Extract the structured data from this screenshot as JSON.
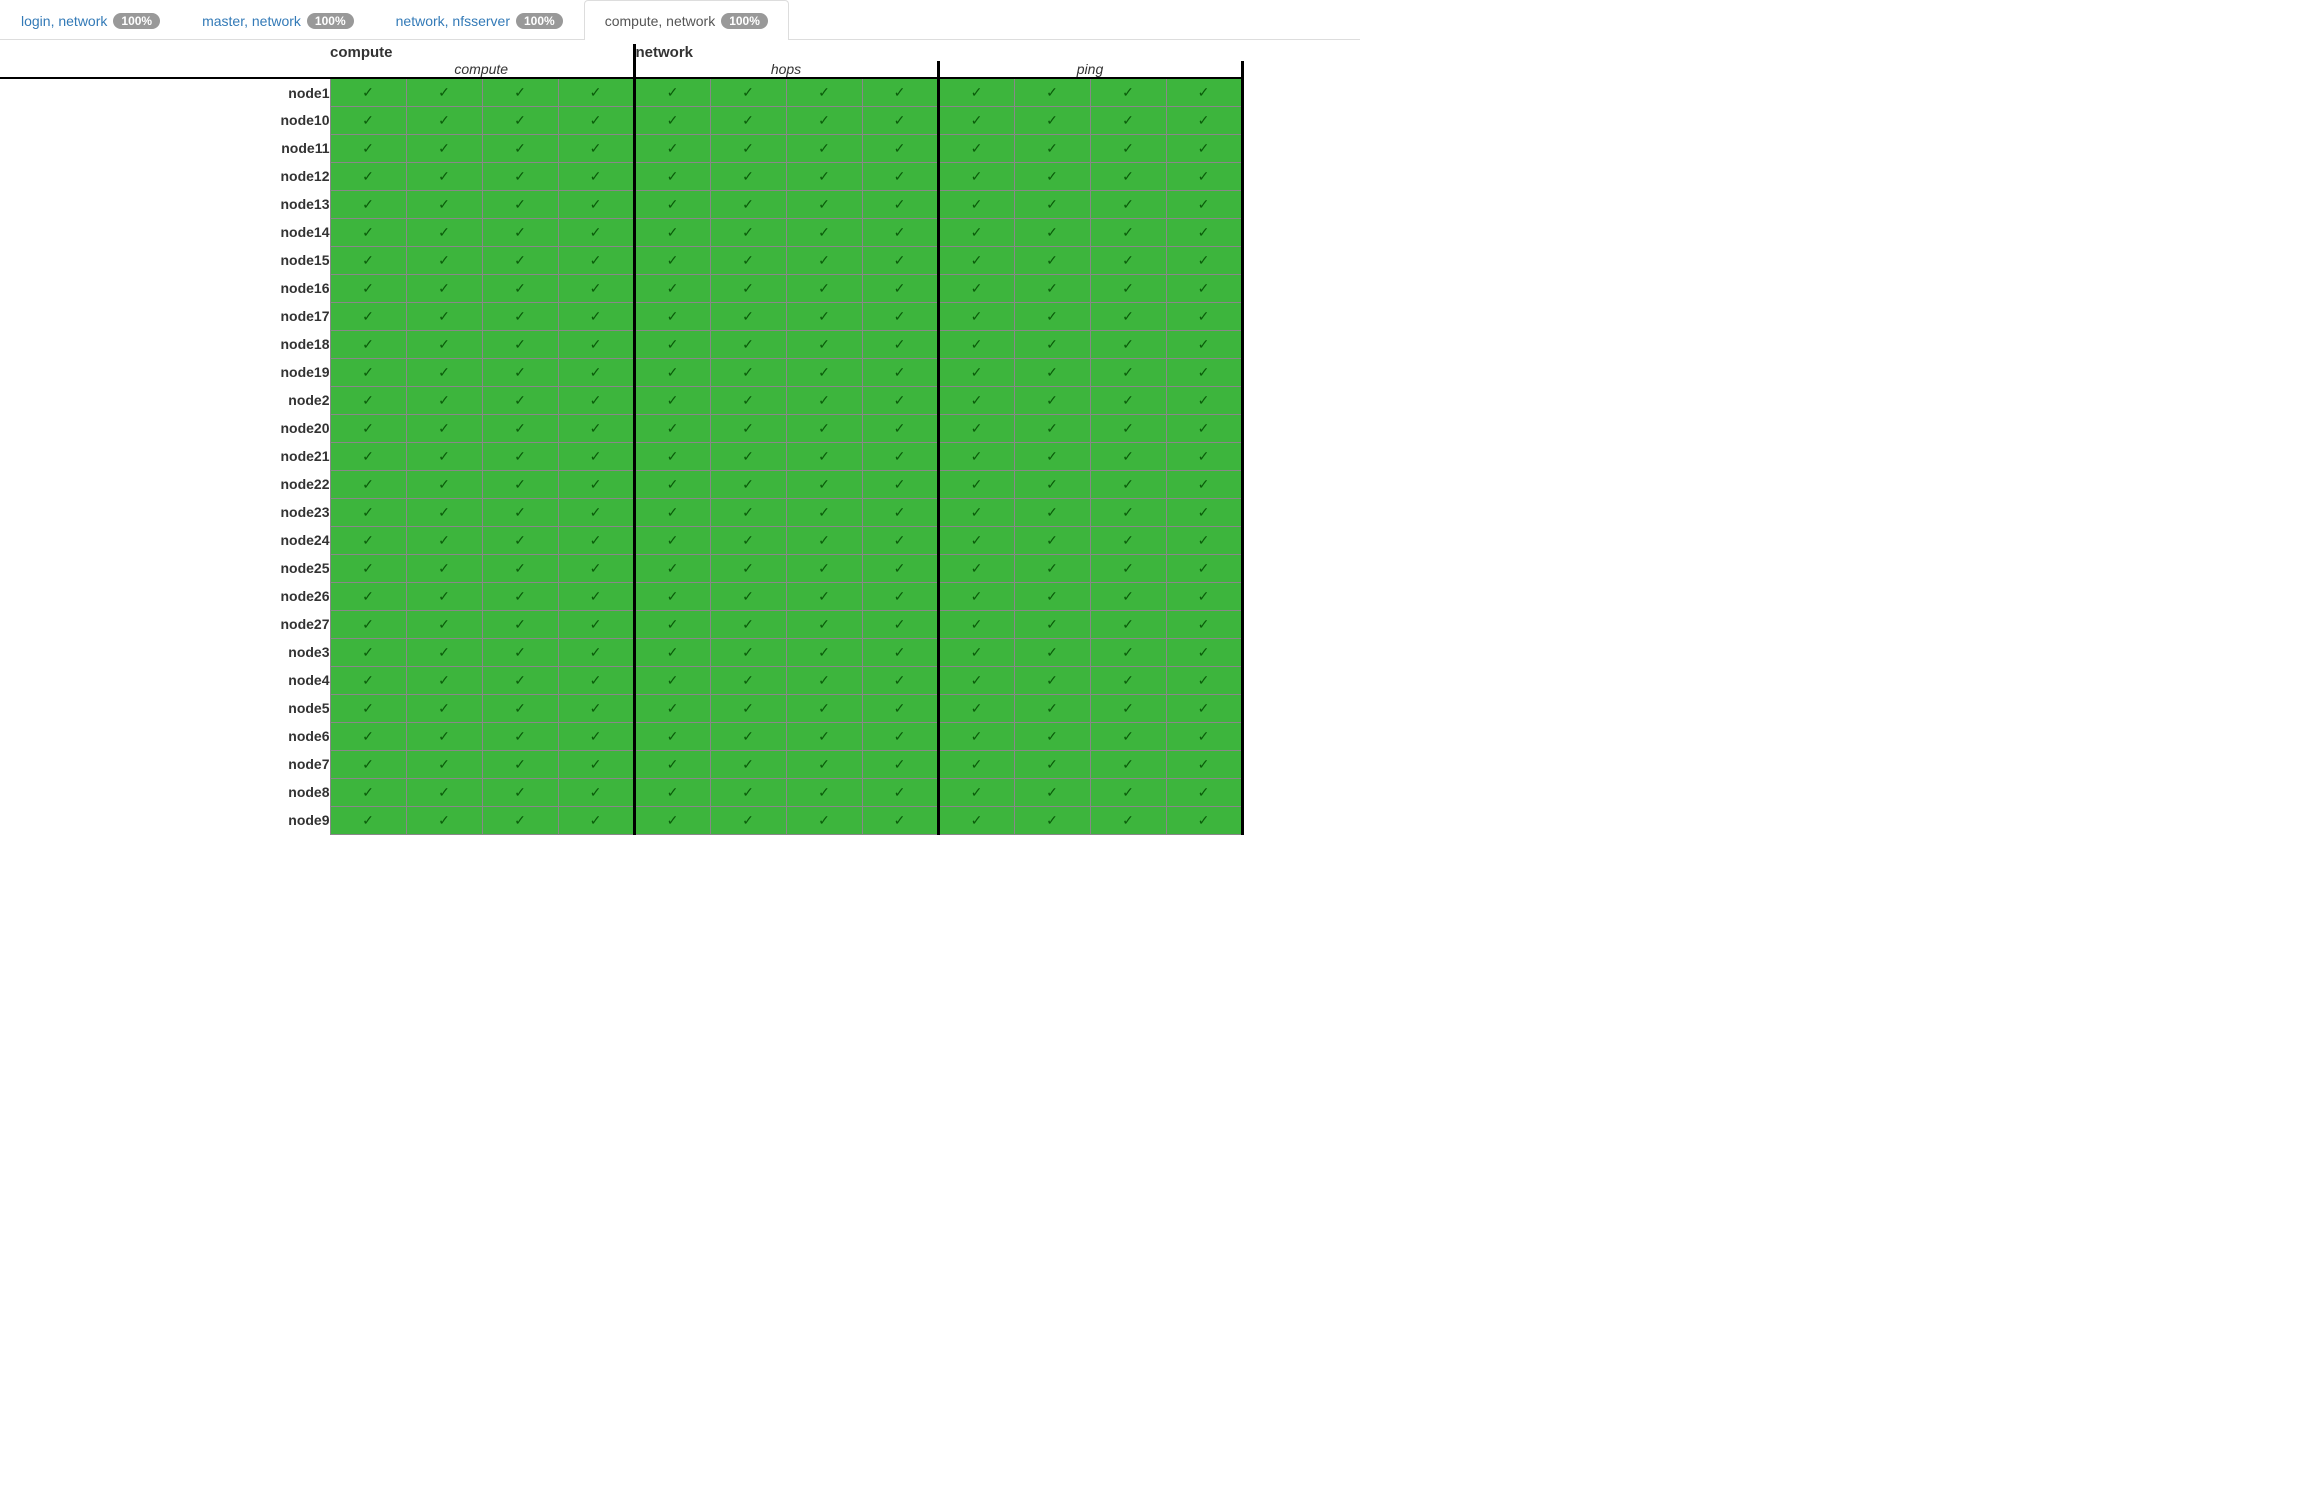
{
  "tabs": [
    {
      "label": "login, network",
      "badge": "100%",
      "active": false
    },
    {
      "label": "master, network",
      "badge": "100%",
      "active": false
    },
    {
      "label": "network, nfsserver",
      "badge": "100%",
      "active": false
    },
    {
      "label": "compute, network",
      "badge": "100%",
      "active": true
    }
  ],
  "groups": [
    {
      "name": "compute",
      "subgroups": [
        {
          "name": "compute",
          "cols": 4
        }
      ]
    },
    {
      "name": "network",
      "subgroups": [
        {
          "name": "hops",
          "cols": 4
        },
        {
          "name": "ping",
          "cols": 4
        }
      ]
    }
  ],
  "check_glyph": "✓",
  "nodes": [
    {
      "label": "node1",
      "cells": [
        "ok",
        "ok",
        "ok",
        "ok",
        "ok",
        "ok",
        "ok",
        "ok",
        "ok",
        "ok",
        "ok",
        "ok"
      ]
    },
    {
      "label": "node10",
      "cells": [
        "ok",
        "ok",
        "ok",
        "ok",
        "ok",
        "ok",
        "ok",
        "ok",
        "ok",
        "ok",
        "ok",
        "ok"
      ]
    },
    {
      "label": "node11",
      "cells": [
        "ok",
        "ok",
        "ok",
        "ok",
        "ok",
        "ok",
        "ok",
        "ok",
        "ok",
        "ok",
        "ok",
        "ok"
      ]
    },
    {
      "label": "node12",
      "cells": [
        "ok",
        "ok",
        "ok",
        "ok",
        "ok",
        "ok",
        "ok",
        "ok",
        "ok",
        "ok",
        "ok",
        "ok"
      ]
    },
    {
      "label": "node13",
      "cells": [
        "ok",
        "ok",
        "ok",
        "ok",
        "ok",
        "ok",
        "ok",
        "ok",
        "ok",
        "ok",
        "ok",
        "ok"
      ]
    },
    {
      "label": "node14",
      "cells": [
        "ok",
        "ok",
        "ok",
        "ok",
        "ok",
        "ok",
        "ok",
        "ok",
        "ok",
        "ok",
        "ok",
        "ok"
      ]
    },
    {
      "label": "node15",
      "cells": [
        "ok",
        "ok",
        "ok",
        "ok",
        "ok",
        "ok",
        "ok",
        "ok",
        "ok",
        "ok",
        "ok",
        "ok"
      ]
    },
    {
      "label": "node16",
      "cells": [
        "ok",
        "ok",
        "ok",
        "ok",
        "ok",
        "ok",
        "ok",
        "ok",
        "ok",
        "ok",
        "ok",
        "ok"
      ]
    },
    {
      "label": "node17",
      "cells": [
        "ok",
        "ok",
        "ok",
        "ok",
        "ok",
        "ok",
        "ok",
        "ok",
        "ok",
        "ok",
        "ok",
        "ok"
      ]
    },
    {
      "label": "node18",
      "cells": [
        "ok",
        "ok",
        "ok",
        "ok",
        "ok",
        "ok",
        "ok",
        "ok",
        "ok",
        "ok",
        "ok",
        "ok"
      ]
    },
    {
      "label": "node19",
      "cells": [
        "ok",
        "ok",
        "ok",
        "ok",
        "ok",
        "ok",
        "ok",
        "ok",
        "ok",
        "ok",
        "ok",
        "ok"
      ]
    },
    {
      "label": "node2",
      "cells": [
        "ok",
        "ok",
        "ok",
        "ok",
        "ok",
        "ok",
        "ok",
        "ok",
        "ok",
        "ok",
        "ok",
        "ok"
      ]
    },
    {
      "label": "node20",
      "cells": [
        "ok",
        "ok",
        "ok",
        "ok",
        "ok",
        "ok",
        "ok",
        "ok",
        "ok",
        "ok",
        "ok",
        "ok"
      ]
    },
    {
      "label": "node21",
      "cells": [
        "ok",
        "ok",
        "ok",
        "ok",
        "ok",
        "ok",
        "ok",
        "ok",
        "ok",
        "ok",
        "ok",
        "ok"
      ]
    },
    {
      "label": "node22",
      "cells": [
        "ok",
        "ok",
        "ok",
        "ok",
        "ok",
        "ok",
        "ok",
        "ok",
        "ok",
        "ok",
        "ok",
        "ok"
      ]
    },
    {
      "label": "node23",
      "cells": [
        "ok",
        "ok",
        "ok",
        "ok",
        "ok",
        "ok",
        "ok",
        "ok",
        "ok",
        "ok",
        "ok",
        "ok"
      ]
    },
    {
      "label": "node24",
      "cells": [
        "ok",
        "ok",
        "ok",
        "ok",
        "ok",
        "ok",
        "ok",
        "ok",
        "ok",
        "ok",
        "ok",
        "ok"
      ]
    },
    {
      "label": "node25",
      "cells": [
        "ok",
        "ok",
        "ok",
        "ok",
        "ok",
        "ok",
        "ok",
        "ok",
        "ok",
        "ok",
        "ok",
        "ok"
      ]
    },
    {
      "label": "node26",
      "cells": [
        "ok",
        "ok",
        "ok",
        "ok",
        "ok",
        "ok",
        "ok",
        "ok",
        "ok",
        "ok",
        "ok",
        "ok"
      ]
    },
    {
      "label": "node27",
      "cells": [
        "ok",
        "ok",
        "ok",
        "ok",
        "ok",
        "ok",
        "ok",
        "ok",
        "ok",
        "ok",
        "ok",
        "ok"
      ]
    },
    {
      "label": "node3",
      "cells": [
        "ok",
        "ok",
        "ok",
        "ok",
        "ok",
        "ok",
        "ok",
        "ok",
        "ok",
        "ok",
        "ok",
        "ok"
      ]
    },
    {
      "label": "node4",
      "cells": [
        "ok",
        "ok",
        "ok",
        "ok",
        "ok",
        "ok",
        "ok",
        "ok",
        "ok",
        "ok",
        "ok",
        "ok"
      ]
    },
    {
      "label": "node5",
      "cells": [
        "ok",
        "ok",
        "ok",
        "ok",
        "ok",
        "ok",
        "ok",
        "ok",
        "ok",
        "ok",
        "ok",
        "ok"
      ]
    },
    {
      "label": "node6",
      "cells": [
        "ok",
        "ok",
        "ok",
        "ok",
        "ok",
        "ok",
        "ok",
        "ok",
        "ok",
        "ok",
        "ok",
        "ok"
      ]
    },
    {
      "label": "node7",
      "cells": [
        "ok",
        "ok",
        "ok",
        "ok",
        "ok",
        "ok",
        "ok",
        "ok",
        "ok",
        "ok",
        "ok",
        "ok"
      ]
    },
    {
      "label": "node8",
      "cells": [
        "ok",
        "ok",
        "ok",
        "ok",
        "ok",
        "ok",
        "ok",
        "ok",
        "ok",
        "ok",
        "ok",
        "ok"
      ]
    },
    {
      "label": "node9",
      "cells": [
        "ok",
        "ok",
        "ok",
        "ok",
        "ok",
        "ok",
        "ok",
        "ok",
        "ok",
        "ok",
        "ok",
        "ok"
      ]
    }
  ]
}
